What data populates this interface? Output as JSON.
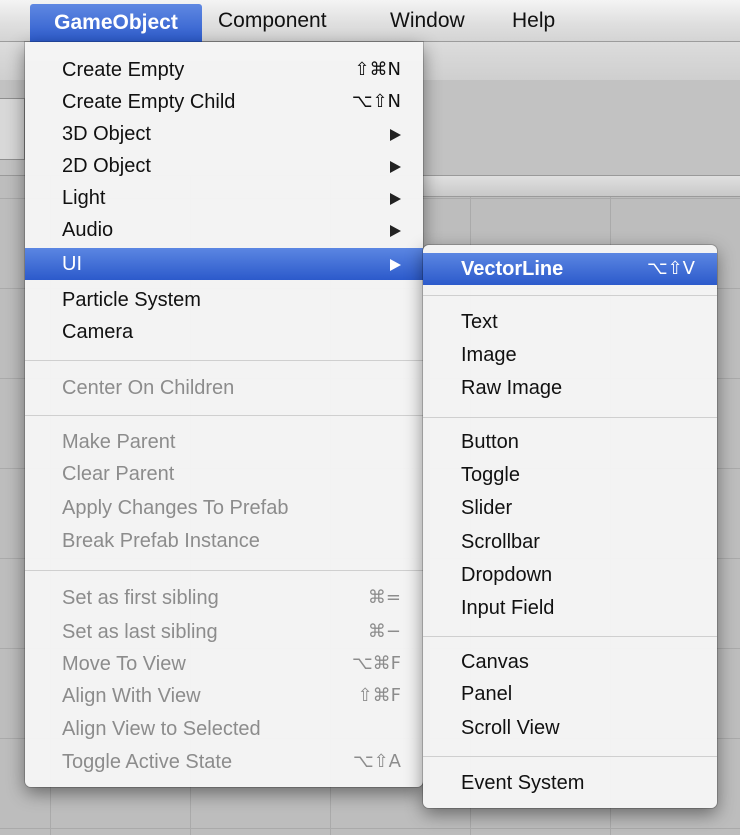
{
  "menubar": {
    "items": [
      {
        "label": "GameObject"
      },
      {
        "label": "Component"
      },
      {
        "label": "Window"
      },
      {
        "label": "Help"
      }
    ]
  },
  "gameobject_menu": {
    "items": [
      {
        "label": "Create Empty",
        "shortcut": "⇧⌘N"
      },
      {
        "label": "Create Empty Child",
        "shortcut": "⌥⇧N"
      },
      {
        "label": "3D Object"
      },
      {
        "label": "2D Object"
      },
      {
        "label": "Light"
      },
      {
        "label": "Audio"
      },
      {
        "label": "UI"
      },
      {
        "label": "Particle System"
      },
      {
        "label": "Camera"
      },
      {
        "label": "Center On Children"
      },
      {
        "label": "Make Parent"
      },
      {
        "label": "Clear Parent"
      },
      {
        "label": "Apply Changes To Prefab"
      },
      {
        "label": "Break Prefab Instance"
      },
      {
        "label": "Set as first sibling",
        "shortcut": "⌘="
      },
      {
        "label": "Set as last sibling",
        "shortcut": "⌘−"
      },
      {
        "label": "Move To View",
        "shortcut": "⌥⌘F"
      },
      {
        "label": "Align With View",
        "shortcut": "⇧⌘F"
      },
      {
        "label": "Align View to Selected"
      },
      {
        "label": "Toggle Active State",
        "shortcut": "⌥⇧A"
      }
    ]
  },
  "ui_submenu": {
    "items": [
      {
        "label": "VectorLine",
        "shortcut": "⌥⇧V"
      },
      {
        "label": "Text"
      },
      {
        "label": "Image"
      },
      {
        "label": "Raw Image"
      },
      {
        "label": "Button"
      },
      {
        "label": "Toggle"
      },
      {
        "label": "Slider"
      },
      {
        "label": "Scrollbar"
      },
      {
        "label": "Dropdown"
      },
      {
        "label": "Input Field"
      },
      {
        "label": "Canvas"
      },
      {
        "label": "Panel"
      },
      {
        "label": "Scroll View"
      },
      {
        "label": "Event System"
      }
    ]
  },
  "colors": {
    "highlight": "#2f5fcf",
    "disabled_text": "#8c8c8c"
  }
}
